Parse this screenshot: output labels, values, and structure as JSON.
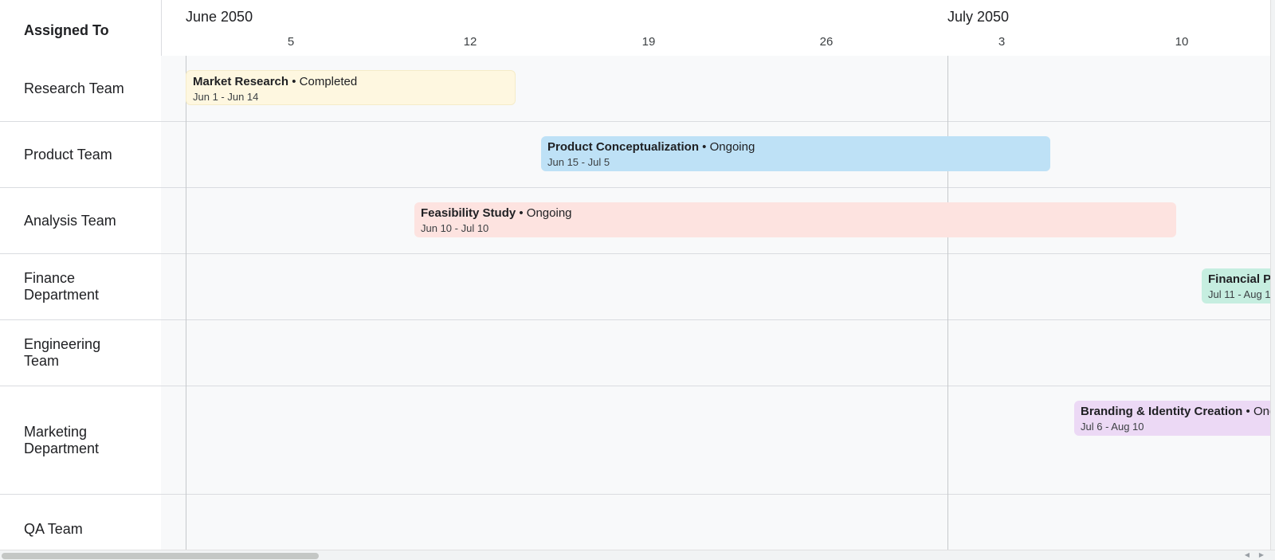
{
  "header": {
    "assigned_to": "Assigned To",
    "months": [
      "June 2050",
      "July 2050"
    ],
    "weeks": [
      "5",
      "12",
      "19",
      "26",
      "3",
      "10"
    ]
  },
  "rows": [
    {
      "label": "Research Team"
    },
    {
      "label": "Product Team"
    },
    {
      "label": "Analysis Team"
    },
    {
      "label": "Finance Department"
    },
    {
      "label": "Engineering Team"
    },
    {
      "label": "Marketing Department"
    },
    {
      "label": "QA Team"
    }
  ],
  "tasks": [
    {
      "name": "Market Research",
      "status": "Completed",
      "dates": "Jun 1 - Jun 14",
      "color": "#fef7e0"
    },
    {
      "name": "Product Conceptualization",
      "status": "Ongoing",
      "dates": "Jun 15 - Jul 5",
      "color": "#bee1f6"
    },
    {
      "name": "Feasibility Study",
      "status": "Ongoing",
      "dates": "Jun 10 - Jul 10",
      "color": "#fde3e0"
    },
    {
      "name": "Financial Pl",
      "status": "",
      "dates": "Jul 11 - Aug 1",
      "color": "#c6eee0"
    },
    {
      "name": "Branding & Identity Creation",
      "status": "Ong",
      "dates": "Jul 6 - Aug 10",
      "color": "#ecd9f5"
    }
  ],
  "separator": " • "
}
